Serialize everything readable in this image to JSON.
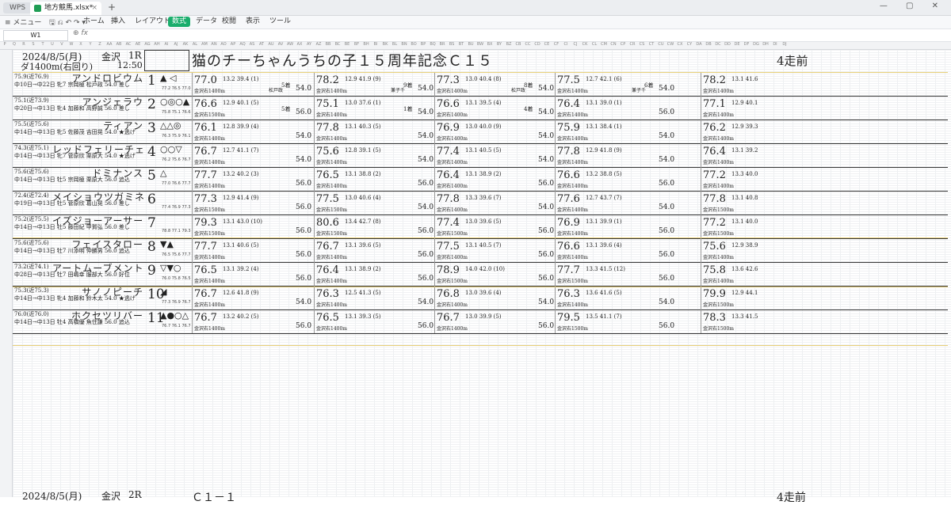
{
  "titlebar": {
    "app": "WPS",
    "tab": "地方競馬.xlsx*",
    "new_tab": "+"
  },
  "menubar": {
    "menu": "≡ メニュー",
    "tabs": [
      "ホーム",
      "挿入",
      "レイアウト",
      "数式",
      "データ",
      "校閲",
      "表示",
      "ツール"
    ],
    "active_tab": "数式"
  },
  "formula_bar": {
    "cell": "W1",
    "fx": "fx",
    "value": ""
  },
  "columns": [
    "P",
    "Q",
    "R",
    "S",
    "T",
    "U",
    "V",
    "W",
    "X",
    "Y",
    "Z",
    "AA",
    "AB",
    "AC",
    "AE",
    "AG",
    "AH",
    "AI",
    "AJ",
    "AK",
    "AL",
    "AM",
    "AN",
    "AO",
    "AP",
    "AQ",
    "AS",
    "AT",
    "AU",
    "AV",
    "AW",
    "AX",
    "AY",
    "AZ",
    "BB",
    "BC",
    "BE",
    "BF",
    "BH",
    "BI",
    "BK",
    "BL",
    "BN",
    "BO",
    "BP",
    "BQ",
    "BR",
    "BS",
    "BT",
    "BU",
    "BW",
    "BX",
    "BY",
    "BZ",
    "CB",
    "CC",
    "CD",
    "CE",
    "CF",
    "CI",
    "CJ",
    "CK",
    "CL",
    "CM",
    "CN",
    "CP",
    "CR",
    "CS",
    "CT",
    "CU",
    "CW",
    "CX",
    "CY",
    "DA",
    "DB",
    "DC",
    "DD",
    "DE",
    "DF",
    "DG",
    "DH",
    "DI",
    "DJ"
  ],
  "header": {
    "date": "2024/8/5(月)",
    "venue": "金沢",
    "race": "1R",
    "distance": "ダ1400m(右回り)",
    "time": "12:50",
    "title": "猫のチーちゃんうちの子１５周年記念Ｃ１５",
    "right_title": "4走前"
  },
  "horses": [
    {
      "rating": "75.9(近76.9)",
      "name": "アンドロビウム",
      "info": "中10日→中22日 牝7 宗岡極 松戸政 54.0 差し",
      "num": "1",
      "marks": "▲ ◁",
      "mini": "77.2 76.5 77.0",
      "past": [
        {
          "spd": "77.0",
          "sm": "13.2 39.4 (1)",
          "pl": "",
          "grade": "5着",
          "crs": "金沢右1400m",
          "res": "",
          "res2": "",
          "jk": "松戸政",
          "wt": "54.0"
        },
        {
          "spd": "78.2",
          "sm": "12.9 41.9 (9)",
          "pl": "",
          "grade": "9着",
          "crs": "金沢右1400m",
          "res": "",
          "res2": "",
          "jk": "兼子千",
          "wt": "54.0"
        },
        {
          "spd": "77.3",
          "sm": "13.0 40.4 (8)",
          "pl": "",
          "grade": "8着",
          "crs": "金沢右1400m",
          "res": "",
          "res2": "",
          "jk": "松戸政",
          "wt": "54.0"
        },
        {
          "spd": "77.5",
          "sm": "12.7 42.1 (6)",
          "pl": "",
          "grade": "6着",
          "crs": "金沢右1400m",
          "res": "",
          "res2": "",
          "jk": "兼子千",
          "wt": "54.0"
        },
        {
          "spd": "78.2",
          "sm": "13.1 41.6",
          "pl": "",
          "grade": "",
          "crs": "金沢右1400m",
          "res": "",
          "res2": "",
          "jk": "",
          "wt": ""
        }
      ]
    },
    {
      "rating": "75.1(近73.9)",
      "name": "アンジェラウ",
      "info": "中20日→中13日 牝4 加藤和 高野誠 56.0 差し",
      "num": "2",
      "marks": "○◎○▲",
      "mini": "75.8 75.1 76.6",
      "past": [
        {
          "spd": "76.6",
          "sm": "12.9 40.1 (5)",
          "pl": "",
          "grade": "5着",
          "crs": "金沢右1500m",
          "res": "",
          "res2": "",
          "jk": "",
          "wt": "56.0"
        },
        {
          "spd": "75.1",
          "sm": "13.0 37.6 (1)",
          "pl": "",
          "grade": "1着",
          "crs": "金沢右1400m",
          "res": "",
          "res2": "",
          "jk": "",
          "wt": "54.0"
        },
        {
          "spd": "76.6",
          "sm": "13.1 39.5 (4)",
          "pl": "",
          "grade": "4着",
          "crs": "金沢右1400m",
          "res": "",
          "res2": "",
          "jk": "",
          "wt": "54.0"
        },
        {
          "spd": "76.4",
          "sm": "13.1 39.0 (1)",
          "pl": "",
          "grade": "",
          "crs": "金沢右1400m",
          "res": "",
          "res2": "",
          "jk": "",
          "wt": "56.0"
        },
        {
          "spd": "77.1",
          "sm": "12.9 40.1",
          "pl": "",
          "grade": "",
          "crs": "金沢右1400m",
          "res": "",
          "res2": "",
          "jk": "",
          "wt": ""
        }
      ]
    },
    {
      "rating": "75.5(近75.6)",
      "name": "ティアン",
      "info": "中14日→中13日 牝5 佐藤茂 吉田晃 54.0 ★逃げ",
      "num": "3",
      "marks": "△△◎",
      "mini": "76.3 75.9 76.1",
      "past": [
        {
          "spd": "76.1",
          "sm": "12.8 39.9 (4)",
          "pl": "",
          "grade": "",
          "crs": "金沢右1400m",
          "res": "",
          "res2": "",
          "jk": "",
          "wt": "54.0"
        },
        {
          "spd": "77.8",
          "sm": "13.1 40.3 (5)",
          "pl": "",
          "grade": "",
          "crs": "金沢右1400m",
          "res": "",
          "res2": "",
          "jk": "",
          "wt": "54.0"
        },
        {
          "spd": "76.9",
          "sm": "13.0 40.0 (9)",
          "pl": "",
          "grade": "",
          "crs": "金沢右1400m",
          "res": "",
          "res2": "",
          "jk": "",
          "wt": "54.0"
        },
        {
          "spd": "75.9",
          "sm": "13.1 38.4 (1)",
          "pl": "",
          "grade": "",
          "crs": "金沢右1400m",
          "res": "",
          "res2": "",
          "jk": "",
          "wt": "54.0"
        },
        {
          "spd": "76.2",
          "sm": "12.9 39.3",
          "pl": "",
          "grade": "",
          "crs": "金沢右1400m",
          "res": "",
          "res2": "",
          "jk": "",
          "wt": ""
        }
      ]
    },
    {
      "rating": "74.3(近75.1)",
      "name": "レッドフェリーチェ",
      "info": "中14日→中13日 牝7 菅原欣 栗原大 54.0 ★逃げ",
      "num": "4",
      "marks": "○○▽",
      "mini": "76.2 75.6 76.7",
      "past": [
        {
          "spd": "76.7",
          "sm": "12.7 41.1 (7)",
          "pl": "",
          "grade": "",
          "crs": "金沢右1400m",
          "res": "",
          "res2": "",
          "jk": "",
          "wt": "54.0"
        },
        {
          "spd": "75.6",
          "sm": "12.8 39.1 (5)",
          "pl": "",
          "grade": "",
          "crs": "金沢右1400m",
          "res": "",
          "res2": "",
          "jk": "",
          "wt": "54.0"
        },
        {
          "spd": "77.4",
          "sm": "13.1 40.5 (5)",
          "pl": "",
          "grade": "",
          "crs": "金沢右1400m",
          "res": "",
          "res2": "",
          "jk": "",
          "wt": "54.0"
        },
        {
          "spd": "77.8",
          "sm": "12.9 41.8 (9)",
          "pl": "",
          "grade": "",
          "crs": "金沢右1400m",
          "res": "",
          "res2": "",
          "jk": "",
          "wt": "54.0"
        },
        {
          "spd": "76.4",
          "sm": "13.1 39.2",
          "pl": "",
          "grade": "",
          "crs": "金沢右1400m",
          "res": "",
          "res2": "",
          "jk": "",
          "wt": ""
        }
      ]
    },
    {
      "rating": "75.6(近75.6)",
      "name": "ドミナンス",
      "info": "中14日→中13日 牡5 宗岡極 栗原大 56.0 追込",
      "num": "5",
      "marks": "△",
      "mini": "77.0 76.6 77.7",
      "past": [
        {
          "spd": "77.7",
          "sm": "13.2 40.2 (3)",
          "pl": "",
          "grade": "",
          "crs": "金沢右1400m",
          "res": "",
          "res2": "",
          "jk": "",
          "wt": "56.0"
        },
        {
          "spd": "76.5",
          "sm": "13.1 38.8 (2)",
          "pl": "",
          "grade": "",
          "crs": "金沢右1400m",
          "res": "",
          "res2": "",
          "jk": "",
          "wt": "56.0"
        },
        {
          "spd": "76.4",
          "sm": "13.1 38.9 (2)",
          "pl": "",
          "grade": "",
          "crs": "金沢右1400m",
          "res": "",
          "res2": "",
          "jk": "",
          "wt": "56.0"
        },
        {
          "spd": "76.6",
          "sm": "13.2 38.8 (5)",
          "pl": "",
          "grade": "",
          "crs": "金沢右1400m",
          "res": "",
          "res2": "",
          "jk": "",
          "wt": "56.0"
        },
        {
          "spd": "77.2",
          "sm": "13.3 40.0",
          "pl": "",
          "grade": "",
          "crs": "金沢右1400m",
          "res": "",
          "res2": "",
          "jk": "",
          "wt": ""
        }
      ]
    },
    {
      "rating": "72.4(近72.4)",
      "name": "メイショウツガミネ",
      "info": "中19日→中13日 牡5 菅原欣 葛山晃 56.0 差し",
      "num": "6",
      "marks": "",
      "mini": "77.4 76.9 77.3",
      "past": [
        {
          "spd": "77.3",
          "sm": "12.9 41.4 (9)",
          "pl": "",
          "grade": "",
          "crs": "金沢右1500m",
          "res": "",
          "res2": "",
          "jk": "",
          "wt": "56.0"
        },
        {
          "spd": "77.5",
          "sm": "13.0 40.6 (4)",
          "pl": "",
          "grade": "",
          "crs": "金沢右1500m",
          "res": "",
          "res2": "",
          "jk": "",
          "wt": "54.0"
        },
        {
          "spd": "77.8",
          "sm": "13.3 39.6 (7)",
          "pl": "",
          "grade": "",
          "crs": "金沢右1400m",
          "res": "",
          "res2": "",
          "jk": "",
          "wt": "54.0"
        },
        {
          "spd": "77.6",
          "sm": "12.7 43.7 (7)",
          "pl": "",
          "grade": "",
          "crs": "金沢右1400m",
          "res": "",
          "res2": "",
          "jk": "",
          "wt": "54.0"
        },
        {
          "spd": "77.8",
          "sm": "13.1 40.8",
          "pl": "",
          "grade": "",
          "crs": "金沢右1500m",
          "res": "",
          "res2": "",
          "jk": "",
          "wt": ""
        }
      ]
    },
    {
      "rating": "75.2(近75.5)",
      "name": "イズジョーアーサー",
      "info": "中14日→中13日 牡5 藤田紀 甲賀弘 56.0 差し",
      "num": "7",
      "marks": "",
      "mini": "78.8 77.1 79.3",
      "past": [
        {
          "spd": "79.3",
          "sm": "13.1 43.0 (10)",
          "pl": "",
          "grade": "",
          "crs": "金沢右1500m",
          "res": "",
          "res2": "",
          "jk": "",
          "wt": "56.0"
        },
        {
          "spd": "80.6",
          "sm": "13.4 42.7 (8)",
          "pl": "",
          "grade": "",
          "crs": "金沢右1500m",
          "res": "",
          "res2": "",
          "jk": "",
          "wt": "56.0"
        },
        {
          "spd": "77.4",
          "sm": "13.0 39.6 (5)",
          "pl": "",
          "grade": "",
          "crs": "金沢右1500m",
          "res": "",
          "res2": "",
          "jk": "",
          "wt": "56.0"
        },
        {
          "spd": "76.9",
          "sm": "13.1 39.9 (1)",
          "pl": "",
          "grade": "",
          "crs": "金沢右1400m",
          "res": "",
          "res2": "",
          "jk": "",
          "wt": "56.0"
        },
        {
          "spd": "77.2",
          "sm": "13.1 40.0",
          "pl": "",
          "grade": "",
          "crs": "金沢右1500m",
          "res": "",
          "res2": "",
          "jk": "",
          "wt": ""
        }
      ]
    },
    {
      "rating": "75.6(近75.6)",
      "name": "フェイスタロー",
      "info": "中14日→中13日 牡7 川添明 仲勝男 56.0 追込",
      "num": "8",
      "marks": "▼▲",
      "mini": "76.5 75.6 77.7",
      "past": [
        {
          "spd": "77.7",
          "sm": "13.1 40.6 (5)",
          "pl": "",
          "grade": "",
          "crs": "金沢右1400m",
          "res": "",
          "res2": "",
          "jk": "",
          "wt": "56.0"
        },
        {
          "spd": "76.7",
          "sm": "13.1 39.6 (5)",
          "pl": "",
          "grade": "",
          "crs": "金沢右1400m",
          "res": "",
          "res2": "",
          "jk": "",
          "wt": "56.0"
        },
        {
          "spd": "77.5",
          "sm": "13.1 40.5 (7)",
          "pl": "",
          "grade": "",
          "crs": "金沢右1400m",
          "res": "",
          "res2": "",
          "jk": "",
          "wt": "56.0"
        },
        {
          "spd": "76.6",
          "sm": "13.1 39.6 (4)",
          "pl": "",
          "grade": "",
          "crs": "金沢右1400m",
          "res": "",
          "res2": "",
          "jk": "",
          "wt": "56.0"
        },
        {
          "spd": "75.6",
          "sm": "12.9 38.9",
          "pl": "",
          "grade": "",
          "crs": "金沢右1400m",
          "res": "",
          "res2": "",
          "jk": "",
          "wt": ""
        }
      ]
    },
    {
      "rating": "73.2(近74.1)",
      "name": "アートムーブメント",
      "info": "中28日→中13日 牡7 田嶋幸 服部大 56.0 好位",
      "num": "9",
      "marks": "▽▼○",
      "mini": "76.0 75.8 76.5",
      "past": [
        {
          "spd": "76.5",
          "sm": "13.1 39.2 (4)",
          "pl": "",
          "grade": "",
          "crs": "金沢右1400m",
          "res": "",
          "res2": "",
          "jk": "",
          "wt": "56.0"
        },
        {
          "spd": "76.4",
          "sm": "13.1 38.9 (2)",
          "pl": "",
          "grade": "",
          "crs": "金沢右1400m",
          "res": "",
          "res2": "",
          "jk": "",
          "wt": "56.0"
        },
        {
          "spd": "78.9",
          "sm": "14.0 42.0 (10)",
          "pl": "",
          "grade": "",
          "crs": "金沢右1500m",
          "res": "",
          "res2": "",
          "jk": "",
          "wt": "56.0"
        },
        {
          "spd": "77.7",
          "sm": "13.3 41.5 (12)",
          "pl": "",
          "grade": "",
          "crs": "金沢右1500m",
          "res": "",
          "res2": "",
          "jk": "",
          "wt": "56.0"
        },
        {
          "spd": "75.8",
          "sm": "13.6 42.6",
          "pl": "",
          "grade": "",
          "crs": "金沢右1400m",
          "res": "",
          "res2": "",
          "jk": "",
          "wt": ""
        }
      ]
    },
    {
      "rating": "75.3(近75.3)",
      "name": "サノノピーチ",
      "info": "中14日→中13日 牝4 加藤和 鈴木太 54.0 ★逃げ",
      "num": "10",
      "marks": "◢",
      "mini": "77.3 76.9 76.7",
      "past": [
        {
          "spd": "76.7",
          "sm": "12.6 41.8 (9)",
          "pl": "",
          "grade": "",
          "crs": "金沢右1400m",
          "res": "",
          "res2": "",
          "jk": "",
          "wt": "54.0"
        },
        {
          "spd": "76.3",
          "sm": "12.5 41.3 (5)",
          "pl": "",
          "grade": "",
          "crs": "金沢右1400m",
          "res": "",
          "res2": "",
          "jk": "",
          "wt": "54.0"
        },
        {
          "spd": "76.8",
          "sm": "13.0 39.6 (4)",
          "pl": "",
          "grade": "",
          "crs": "金沢右1400m",
          "res": "",
          "res2": "",
          "jk": "",
          "wt": "54.0"
        },
        {
          "spd": "76.3",
          "sm": "13.6 41.6 (5)",
          "pl": "",
          "grade": "",
          "crs": "金沢右1400m",
          "res": "",
          "res2": "",
          "jk": "",
          "wt": "54.0"
        },
        {
          "spd": "79.9",
          "sm": "12.9 44.1",
          "pl": "",
          "grade": "",
          "crs": "金沢右1500m",
          "res": "",
          "res2": "",
          "jk": "",
          "wt": ""
        }
      ]
    },
    {
      "rating": "76.0(近76.0)",
      "name": "ホクセツリバー",
      "info": "中14日→中13日 牡4 高橋優 魚住謙 56.0 追込",
      "num": "11",
      "marks": "▲●○△",
      "mini": "76.7 76.1 76.7",
      "past": [
        {
          "spd": "76.7",
          "sm": "13.2 40.2 (5)",
          "pl": "",
          "grade": "",
          "crs": "金沢右1400m",
          "res": "",
          "res2": "",
          "jk": "",
          "wt": "56.0"
        },
        {
          "spd": "76.5",
          "sm": "13.1 39.3 (5)",
          "pl": "",
          "grade": "",
          "crs": "金沢右1400m",
          "res": "",
          "res2": "",
          "jk": "",
          "wt": "56.0"
        },
        {
          "spd": "76.7",
          "sm": "13.0 39.9 (5)",
          "pl": "",
          "grade": "",
          "crs": "金沢右1400m",
          "res": "",
          "res2": "",
          "jk": "",
          "wt": "56.0"
        },
        {
          "spd": "79.5",
          "sm": "13.5 41.1 (7)",
          "pl": "",
          "grade": "",
          "crs": "金沢右1500m",
          "res": "",
          "res2": "",
          "jk": "",
          "wt": "56.0"
        },
        {
          "spd": "78.3",
          "sm": "13.3 41.5",
          "pl": "",
          "grade": "",
          "crs": "金沢右1500m",
          "res": "",
          "res2": "",
          "jk": "",
          "wt": ""
        }
      ]
    }
  ],
  "bottom": {
    "date": "2024/8/5(月)",
    "venue": "金沢",
    "race": "2R",
    "title": "Ｃ１－１",
    "right_title": "4走前"
  }
}
